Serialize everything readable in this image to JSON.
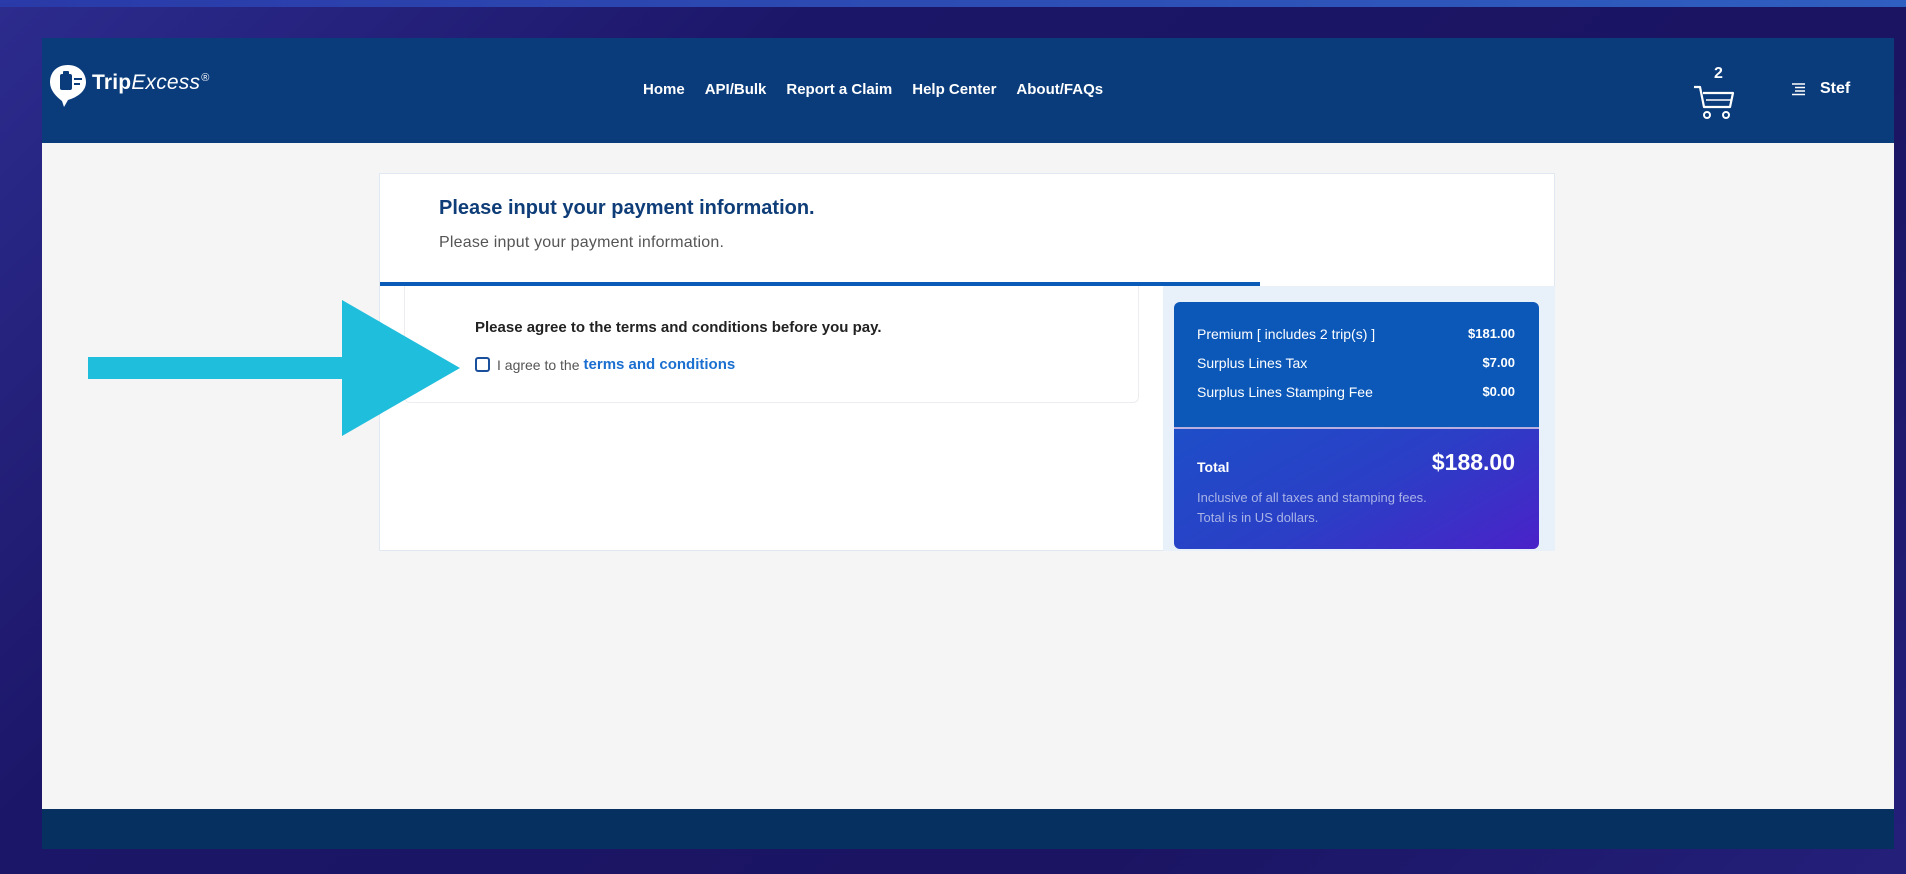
{
  "brand": {
    "name_bold": "Trip",
    "name_italic": "Excess",
    "registered": "®"
  },
  "nav": {
    "items": [
      {
        "label": "Home"
      },
      {
        "label": "API/Bulk"
      },
      {
        "label": "Report a Claim"
      },
      {
        "label": "Help Center"
      },
      {
        "label": "About/FAQs"
      }
    ]
  },
  "cart": {
    "count": "2"
  },
  "user": {
    "name": "Stef"
  },
  "page": {
    "title": "Please input your payment information.",
    "subtitle": "Please input your payment information."
  },
  "terms": {
    "heading": "Please agree to the terms and conditions before you pay.",
    "agree_text": "I agree to the",
    "link_text": "terms and conditions",
    "checked": false
  },
  "summary": {
    "lines": [
      {
        "label": "Premium [ includes 2 trip(s) ]",
        "amount": "$181.00"
      },
      {
        "label": "Surplus Lines Tax",
        "amount": "$7.00"
      },
      {
        "label": "Surplus Lines Stamping Fee",
        "amount": "$0.00"
      }
    ],
    "total_label": "Total",
    "total_amount": "$188.00",
    "notes": [
      "Inclusive of all taxes and stamping fees.",
      "Total is in US dollars."
    ]
  },
  "colors": {
    "header": "#0a3c7c",
    "accent": "#1a6fd0",
    "annotation_arrow": "#1fbedc",
    "footer": "#05305f"
  }
}
